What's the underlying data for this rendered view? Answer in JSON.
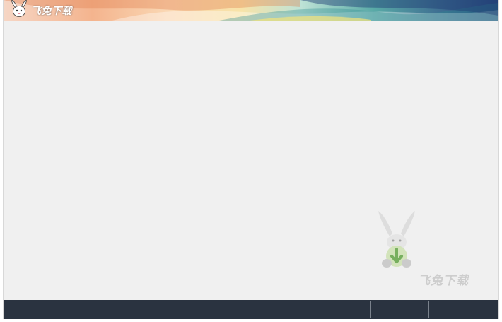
{
  "app": {
    "brand_name": "飞兔下载",
    "logo_icon": "rabbit-logo-icon"
  },
  "watermark": {
    "text": "飞兔下载",
    "icon": "rabbit-download-icon"
  },
  "colors": {
    "content_bg": "#f0f0f0",
    "statusbar_bg": "#2a3340",
    "header_accent_teal": "#3f8f92",
    "header_accent_navy": "#27457c"
  },
  "statusbar": {
    "cells": [
      "",
      "",
      "",
      ""
    ]
  }
}
